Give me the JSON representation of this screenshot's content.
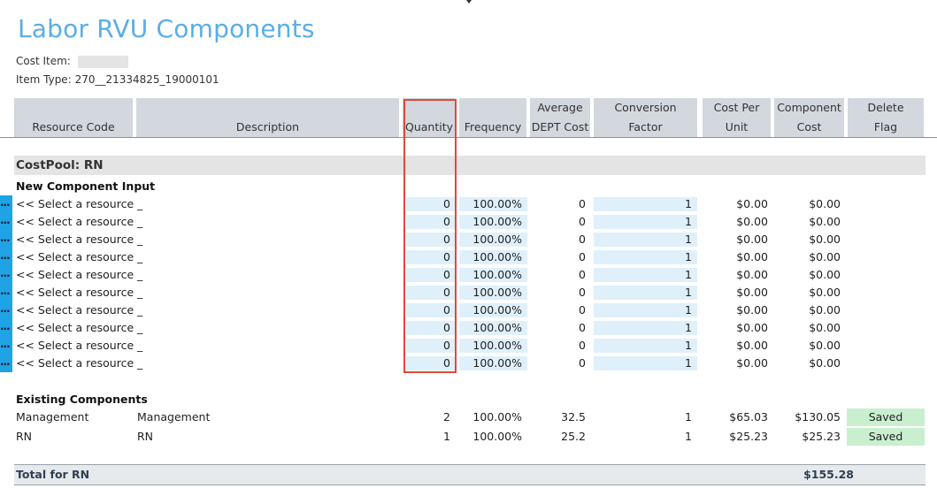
{
  "page": {
    "title": "Labor RVU Components",
    "cost_item_label": "Cost Item:",
    "item_type_label": "Item Type:",
    "item_type_value": "270__21334825_19000101"
  },
  "columns": [
    {
      "line1": "",
      "line2": "Resource Code"
    },
    {
      "line1": "",
      "line2": "Description"
    },
    {
      "line1": "",
      "line2": "Quantity"
    },
    {
      "line1": "",
      "line2": "Frequency"
    },
    {
      "line1": "Average",
      "line2": "DEPT Cost"
    },
    {
      "line1": "Conversion",
      "line2": "Factor"
    },
    {
      "line1": "Cost Per",
      "line2": "Unit"
    },
    {
      "line1": "Component",
      "line2": "Cost"
    },
    {
      "line1": "Delete",
      "line2": "Flag"
    }
  ],
  "costpool": {
    "label": "CostPool: RN",
    "new_section_label": "New Component Input",
    "existing_section_label": "Existing Components",
    "new_rows": [
      {
        "dots": "...",
        "resource": "<< Select a resource",
        "desc": "_",
        "quantity": "0",
        "frequency": "100.00%",
        "avg": "0",
        "factor": "1",
        "cpu": "$0.00",
        "cost": "$0.00"
      },
      {
        "dots": "...",
        "resource": "<< Select a resource",
        "desc": "_",
        "quantity": "0",
        "frequency": "100.00%",
        "avg": "0",
        "factor": "1",
        "cpu": "$0.00",
        "cost": "$0.00"
      },
      {
        "dots": "...",
        "resource": "<< Select a resource",
        "desc": "_",
        "quantity": "0",
        "frequency": "100.00%",
        "avg": "0",
        "factor": "1",
        "cpu": "$0.00",
        "cost": "$0.00"
      },
      {
        "dots": "...",
        "resource": "<< Select a resource",
        "desc": "_",
        "quantity": "0",
        "frequency": "100.00%",
        "avg": "0",
        "factor": "1",
        "cpu": "$0.00",
        "cost": "$0.00"
      },
      {
        "dots": "...",
        "resource": "<< Select a resource",
        "desc": "_",
        "quantity": "0",
        "frequency": "100.00%",
        "avg": "0",
        "factor": "1",
        "cpu": "$0.00",
        "cost": "$0.00"
      },
      {
        "dots": "...",
        "resource": "<< Select a resource",
        "desc": "_",
        "quantity": "0",
        "frequency": "100.00%",
        "avg": "0",
        "factor": "1",
        "cpu": "$0.00",
        "cost": "$0.00"
      },
      {
        "dots": "...",
        "resource": "<< Select a resource",
        "desc": "_",
        "quantity": "0",
        "frequency": "100.00%",
        "avg": "0",
        "factor": "1",
        "cpu": "$0.00",
        "cost": "$0.00"
      },
      {
        "dots": "...",
        "resource": "<< Select a resource",
        "desc": "_",
        "quantity": "0",
        "frequency": "100.00%",
        "avg": "0",
        "factor": "1",
        "cpu": "$0.00",
        "cost": "$0.00"
      },
      {
        "dots": "...",
        "resource": "<< Select a resource",
        "desc": "_",
        "quantity": "0",
        "frequency": "100.00%",
        "avg": "0",
        "factor": "1",
        "cpu": "$0.00",
        "cost": "$0.00"
      },
      {
        "dots": "...",
        "resource": "<< Select a resource",
        "desc": "_",
        "quantity": "0",
        "frequency": "100.00%",
        "avg": "0",
        "factor": "1",
        "cpu": "$0.00",
        "cost": "$0.00"
      }
    ],
    "existing_rows": [
      {
        "resource": "Management",
        "desc": "Management",
        "quantity": "2",
        "frequency": "100.00%",
        "avg": "32.5",
        "factor": "1",
        "cpu": "$65.03",
        "cost": "$130.05",
        "flag": "Saved"
      },
      {
        "resource": "RN",
        "desc": "RN",
        "quantity": "1",
        "frequency": "100.00%",
        "avg": "25.2",
        "factor": "1",
        "cpu": "$25.23",
        "cost": "$25.23",
        "flag": "Saved"
      }
    ],
    "total_label": "Total for RN",
    "total_value": "$155.28"
  },
  "colors": {
    "title": "#5aaee6",
    "header_bg": "#d2d8de",
    "input_bg": "#dff0fb",
    "saved_bg": "#c9efcf",
    "row_handle": "#1ea3e6",
    "highlight": "#e0483b"
  }
}
